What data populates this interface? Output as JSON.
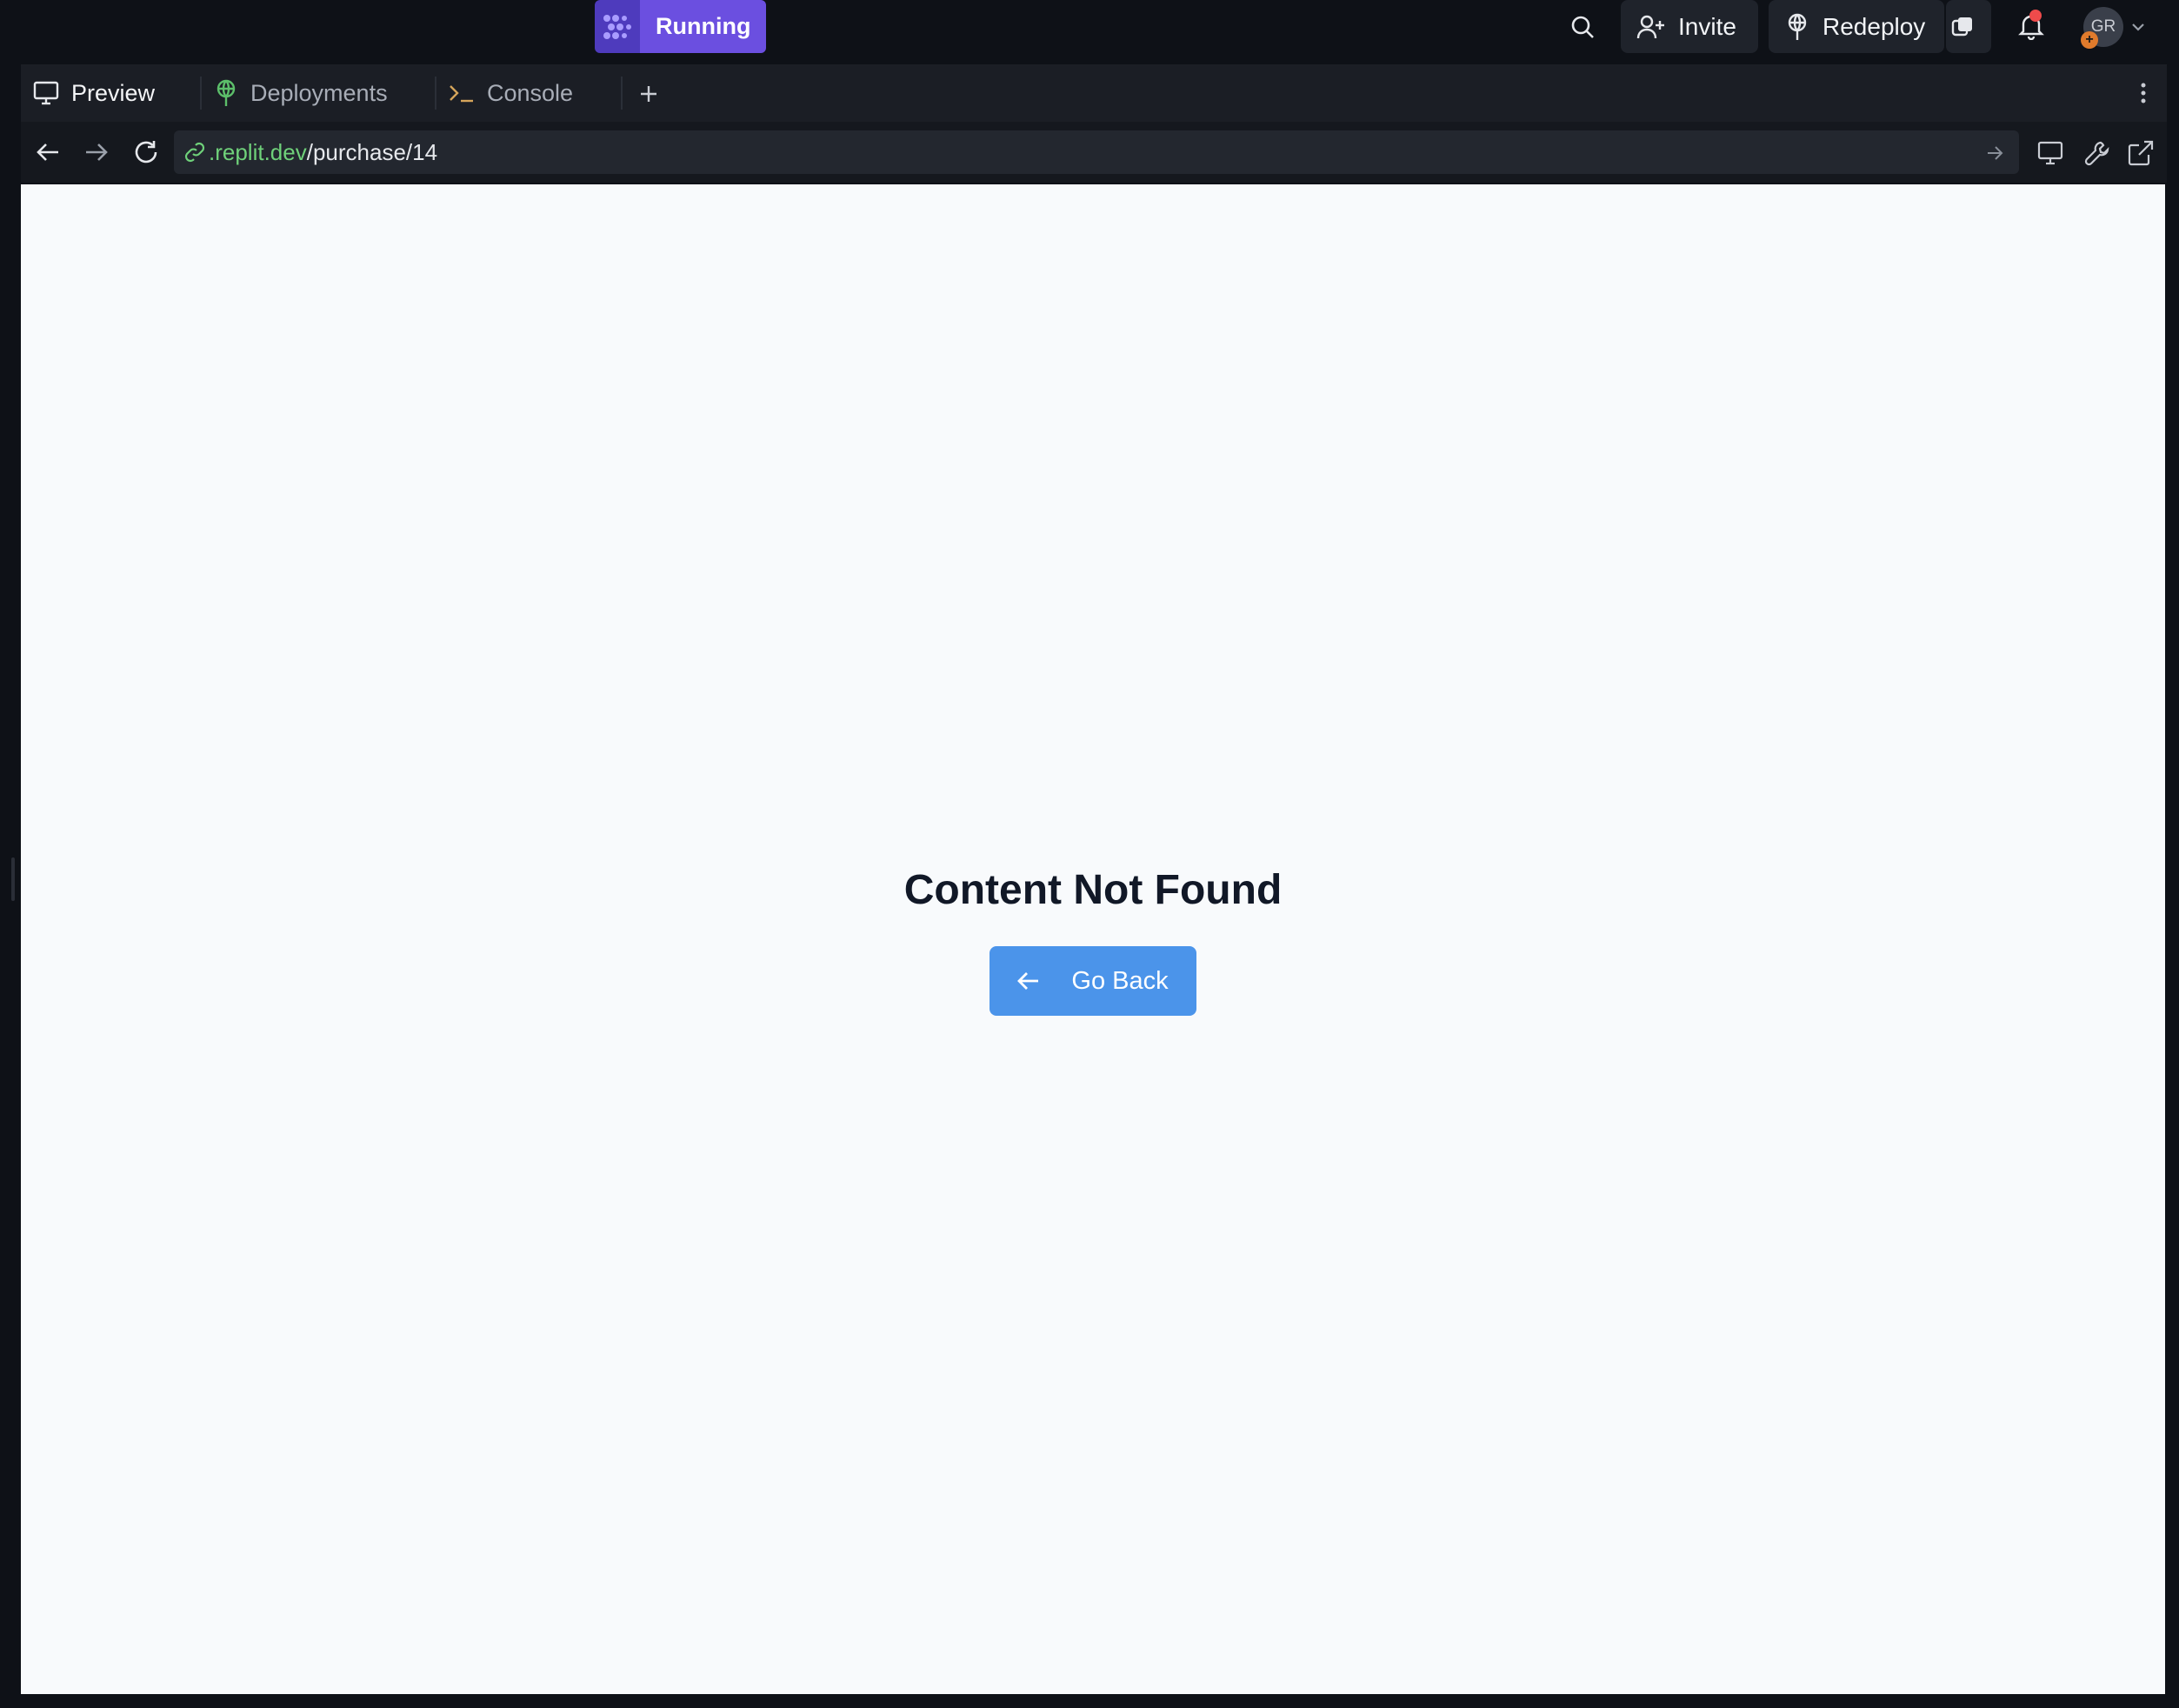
{
  "topbar": {
    "run_label": "Running",
    "invite_label": "Invite",
    "redeploy_label": "Redeploy",
    "avatar_initials": "GR",
    "avatar_badge": "+",
    "accent": "#6b4fe0",
    "notification_dot_color": "#ef4b4b"
  },
  "tabs": [
    {
      "label": "Preview",
      "icon": "monitor-icon"
    },
    {
      "label": "Deployments",
      "icon": "deployments-icon"
    },
    {
      "label": "Console",
      "icon": "terminal-icon"
    }
  ],
  "address": {
    "domain": ".replit.dev",
    "path": "/purchase/14"
  },
  "page": {
    "title": "Content Not Found",
    "button_label": "Go Back",
    "button_color": "#4b94ea"
  }
}
